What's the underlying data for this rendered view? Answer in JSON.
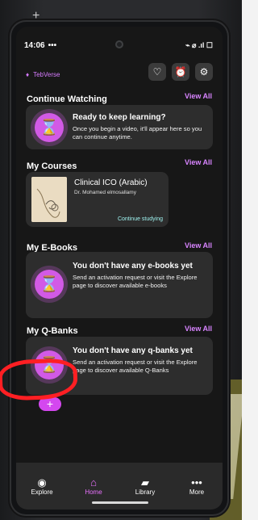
{
  "status": {
    "time": "14:06",
    "dots": "•••",
    "icons": "⌁ ⌀ .ıl ☐"
  },
  "brand": {
    "label": "TebVerse"
  },
  "actions": {
    "heart": "♡",
    "alarm": "⏰",
    "settings": "⚙"
  },
  "continue": {
    "title": "Continue Watching",
    "view_all": "View All",
    "card_title": "Ready to keep learning?",
    "card_body": "Once you begin a video, it'll appear here so you can continue anytime."
  },
  "courses": {
    "title": "My Courses",
    "view_all": "View All",
    "course_name": "Clinical ICO (Arabic)",
    "instructor": "Dr. Mohamed elmosallamy",
    "link": "Continue studying"
  },
  "ebooks": {
    "title": "My E-Books",
    "view_all": "View All",
    "card_title": "You don't have any e-books yet",
    "card_body": "Send an activation request or visit the Explore page to discover available e-books"
  },
  "qbanks": {
    "title": "My Q-Banks",
    "view_all": "View All",
    "card_title": "You don't have any q-banks yet",
    "card_body": "Send an activation request or visit the Explore page to discover available Q-Banks"
  },
  "fab": {
    "label": "+"
  },
  "nav": {
    "explore": "Explore",
    "home": "Home",
    "library": "Library",
    "more": "More"
  },
  "background": {
    "plus": "+"
  }
}
